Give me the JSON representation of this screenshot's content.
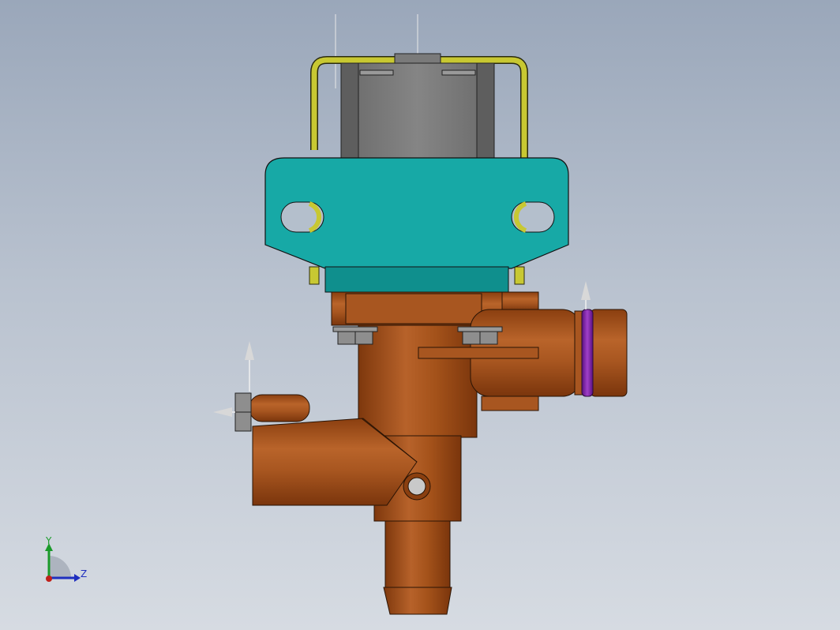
{
  "viewport": {
    "background_top": "#9aa7ba",
    "background_bottom": "#d6dbe2"
  },
  "model": {
    "parts": [
      {
        "name": "coil-housing",
        "color": "#7a7a7a"
      },
      {
        "name": "wire-bracket",
        "color": "#c8c832"
      },
      {
        "name": "mounting-bracket",
        "color": "#17a9a6"
      },
      {
        "name": "valve-body",
        "color": "#a4521a"
      },
      {
        "name": "o-ring",
        "color": "#7b1fa2"
      },
      {
        "name": "hex-nuts",
        "color": "#8e8e8e"
      }
    ]
  },
  "triad": {
    "y_label": "Y",
    "z_label": "Z",
    "y_color": "#1a9a2a",
    "z_color": "#1f2fbf",
    "x_color": "#c0201a"
  }
}
